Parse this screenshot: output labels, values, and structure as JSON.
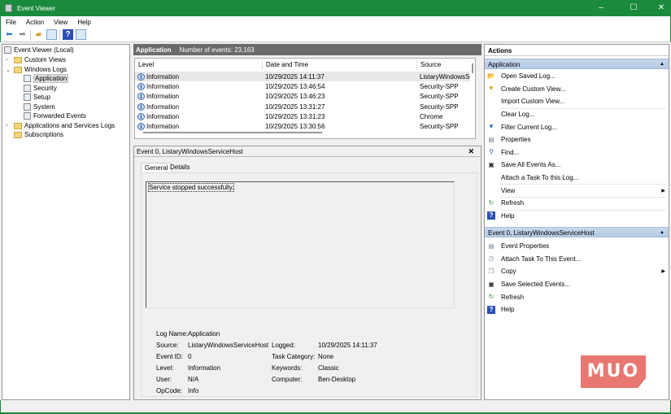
{
  "window": {
    "title": "Event Viewer",
    "minimize": "–",
    "maximize": "☐",
    "close": "✕"
  },
  "menu": [
    "File",
    "Action",
    "View",
    "Help"
  ],
  "tree": {
    "root": "Event Viewer (Local)",
    "custom_views": "Custom Views",
    "windows_logs": "Windows Logs",
    "application": "Application",
    "security": "Security",
    "setup": "Setup",
    "system": "System",
    "forwarded": "Forwarded Events",
    "app_services": "Applications and Services Logs",
    "subscriptions": "Subscriptions"
  },
  "log_header": {
    "name": "Application",
    "count_label": "Number of events: 23,163"
  },
  "columns": [
    "Level",
    "Date and Time",
    "Source"
  ],
  "events": [
    {
      "level": "Information",
      "datetime": "10/29/2025 14:11:37",
      "source": "ListaryWindowsService"
    },
    {
      "level": "Information",
      "datetime": "10/29/2025 13:46:54",
      "source": "Security-SPP"
    },
    {
      "level": "Information",
      "datetime": "10/29/2025 13:46:23",
      "source": "Security-SPP"
    },
    {
      "level": "Information",
      "datetime": "10/29/2025 13:31:27",
      "source": "Security-SPP"
    },
    {
      "level": "Information",
      "datetime": "10/29/2025 13:31:23",
      "source": "Chrome"
    },
    {
      "level": "Information",
      "datetime": "10/29/2025 13:30:56",
      "source": "Security-SPP"
    }
  ],
  "detail": {
    "title": "Event 0, ListaryWindowsServiceHost",
    "tabs": [
      "General",
      "Details"
    ],
    "message": "Service stopped successfully.",
    "fields": {
      "log_name_l": "Log Name:",
      "log_name": "Application",
      "source_l": "Source:",
      "source": "ListaryWindowsServiceHost",
      "logged_l": "Logged:",
      "logged": "10/29/2025 14:11:37",
      "event_id_l": "Event ID:",
      "event_id": "0",
      "task_l": "Task Category:",
      "task": "None",
      "level_l": "Level:",
      "level": "Information",
      "keywords_l": "Keywords:",
      "keywords": "Classic",
      "user_l": "User:",
      "user": "N/A",
      "computer_l": "Computer:",
      "computer": "Ben-Desktop",
      "opcode_l": "OpCode:",
      "opcode": "Info"
    }
  },
  "actions": {
    "title": "Actions",
    "section1": "Application",
    "items1": [
      "Open Saved Log...",
      "Create Custom View...",
      "Import Custom View...",
      "Clear Log...",
      "Filter Current Log...",
      "Properties",
      "Find...",
      "Save All Events As...",
      "Attach a Task To this Log...",
      "View",
      "Refresh",
      "Help"
    ],
    "section2": "Event 0, ListaryWindowsServiceHost",
    "items2": [
      "Event Properties",
      "Attach Task To This Event...",
      "Copy",
      "Save Selected Events...",
      "Refresh",
      "Help"
    ]
  },
  "watermark": "MUO",
  "colors": {
    "titlebar": "#1a8a3c",
    "section": "#c7d8ec",
    "header": "#6b6b6b"
  }
}
